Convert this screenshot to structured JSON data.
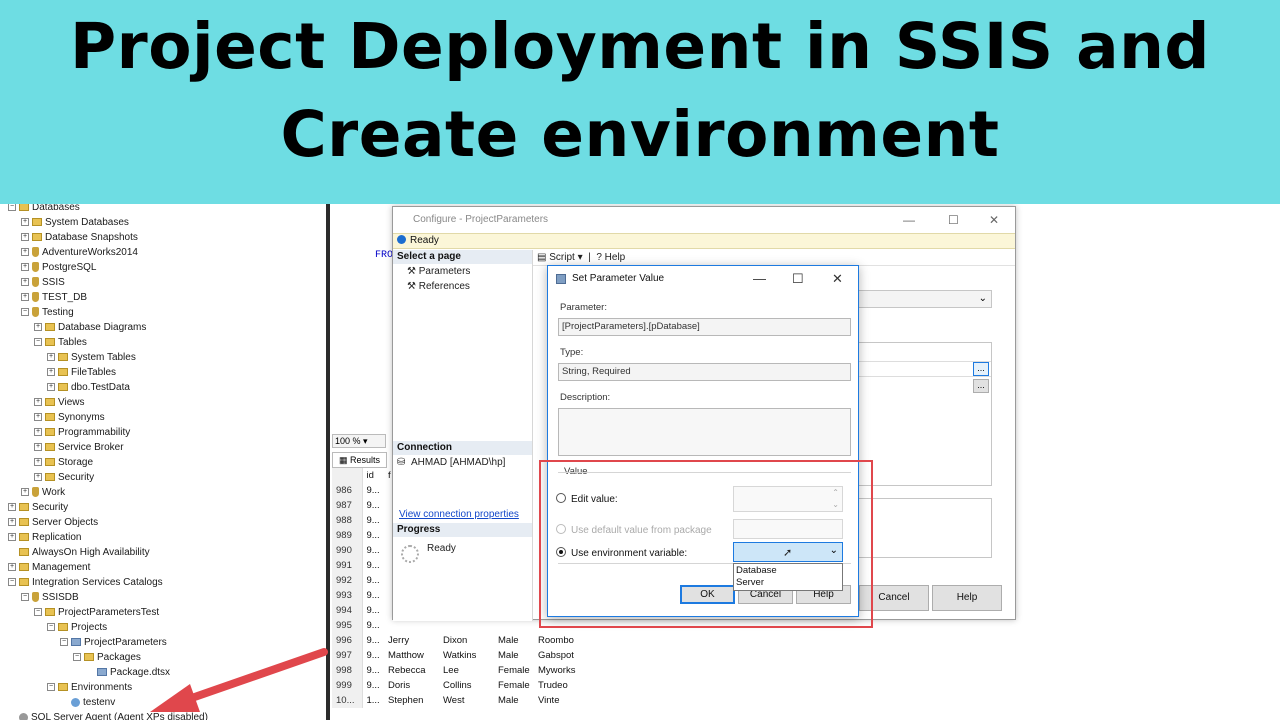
{
  "banner": {
    "line1": "Project Deployment in SSIS and",
    "line2": "Create environment"
  },
  "explorer": {
    "items": [
      {
        "label": "Databases",
        "level": 0,
        "icon": "folder-icon",
        "expander": "−"
      },
      {
        "label": "System Databases",
        "level": 1,
        "icon": "folder-icon",
        "expander": "+"
      },
      {
        "label": "Database Snapshots",
        "level": 1,
        "icon": "folder-icon",
        "expander": "+"
      },
      {
        "label": "AdventureWorks2014",
        "level": 1,
        "icon": "database-icon",
        "expander": "+"
      },
      {
        "label": "PostgreSQL",
        "level": 1,
        "icon": "database-icon",
        "expander": "+"
      },
      {
        "label": "SSIS",
        "level": 1,
        "icon": "database-icon",
        "expander": "+"
      },
      {
        "label": "TEST_DB",
        "level": 1,
        "icon": "database-icon",
        "expander": "+"
      },
      {
        "label": "Testing",
        "level": 1,
        "icon": "database-icon",
        "expander": "−"
      },
      {
        "label": "Database Diagrams",
        "level": 2,
        "icon": "folder-icon",
        "expander": "+"
      },
      {
        "label": "Tables",
        "level": 2,
        "icon": "folder-icon",
        "expander": "−"
      },
      {
        "label": "System Tables",
        "level": 3,
        "icon": "folder-icon",
        "expander": "+"
      },
      {
        "label": "FileTables",
        "level": 3,
        "icon": "folder-icon",
        "expander": "+"
      },
      {
        "label": "dbo.TestData",
        "level": 3,
        "icon": "table-icon",
        "expander": "+"
      },
      {
        "label": "Views",
        "level": 2,
        "icon": "folder-icon",
        "expander": "+"
      },
      {
        "label": "Synonyms",
        "level": 2,
        "icon": "folder-icon",
        "expander": "+"
      },
      {
        "label": "Programmability",
        "level": 2,
        "icon": "folder-icon",
        "expander": "+"
      },
      {
        "label": "Service Broker",
        "level": 2,
        "icon": "folder-icon",
        "expander": "+"
      },
      {
        "label": "Storage",
        "level": 2,
        "icon": "folder-icon",
        "expander": "+"
      },
      {
        "label": "Security",
        "level": 2,
        "icon": "folder-icon",
        "expander": "+"
      },
      {
        "label": "Work",
        "level": 1,
        "icon": "database-icon",
        "expander": "+"
      },
      {
        "label": "Security",
        "level": 0,
        "icon": "folder-icon",
        "expander": "+"
      },
      {
        "label": "Server Objects",
        "level": 0,
        "icon": "folder-icon",
        "expander": "+"
      },
      {
        "label": "Replication",
        "level": 0,
        "icon": "folder-icon",
        "expander": "+"
      },
      {
        "label": "AlwaysOn High Availability",
        "level": 0,
        "icon": "folder-icon",
        "expander": ""
      },
      {
        "label": "Management",
        "level": 0,
        "icon": "folder-icon",
        "expander": "+"
      },
      {
        "label": "Integration Services Catalogs",
        "level": 0,
        "icon": "folder-icon",
        "expander": "−"
      },
      {
        "label": "SSISDB",
        "level": 1,
        "icon": "catalog-icon",
        "expander": "−"
      },
      {
        "label": "ProjectParametersTest",
        "level": 2,
        "icon": "folder-icon",
        "expander": "−"
      },
      {
        "label": "Projects",
        "level": 3,
        "icon": "folder-icon",
        "expander": "−"
      },
      {
        "label": "ProjectParameters",
        "level": 4,
        "icon": "project-icon",
        "expander": "−"
      },
      {
        "label": "Packages",
        "level": 5,
        "icon": "folder-icon",
        "expander": "−"
      },
      {
        "label": "Package.dtsx",
        "level": 6,
        "icon": "package-icon",
        "expander": ""
      },
      {
        "label": "Environments",
        "level": 3,
        "icon": "folder-icon",
        "expander": "−"
      },
      {
        "label": "testenv",
        "level": 4,
        "icon": "environment-icon",
        "expander": ""
      },
      {
        "label": "SQL Server Agent (Agent XPs disabled)",
        "level": 0,
        "icon": "agent-icon",
        "expander": ""
      }
    ]
  },
  "editor": {
    "code_keyword": "FRO",
    "zoom": "100 %",
    "results_tab": "Results",
    "grid_header": [
      "",
      "id",
      "f"
    ],
    "rows": [
      [
        "986",
        "9...",
        "",
        "",
        "",
        ""
      ],
      [
        "987",
        "9...",
        "",
        "",
        "",
        ""
      ],
      [
        "988",
        "9...",
        "",
        "",
        "",
        ""
      ],
      [
        "989",
        "9...",
        "",
        "",
        "",
        ""
      ],
      [
        "990",
        "9...",
        "",
        "",
        "",
        ""
      ],
      [
        "991",
        "9...",
        "",
        "",
        "",
        ""
      ],
      [
        "992",
        "9...",
        "",
        "",
        "",
        ""
      ],
      [
        "993",
        "9...",
        "",
        "",
        "",
        ""
      ],
      [
        "994",
        "9...",
        "",
        "",
        "",
        ""
      ],
      [
        "995",
        "9...",
        "",
        "",
        "",
        ""
      ],
      [
        "996",
        "9...",
        "Jerry",
        "Dixon",
        "Male",
        "Roombo"
      ],
      [
        "997",
        "9...",
        "Matthow",
        "Watkins",
        "Male",
        "Gabspot"
      ],
      [
        "998",
        "9...",
        "Rebecca",
        "Lee",
        "Female",
        "Myworks"
      ],
      [
        "999",
        "9...",
        "Doris",
        "Collins",
        "Female",
        "Trudeo"
      ],
      [
        "10...",
        "1...",
        "Stephen",
        "West",
        "Male",
        "Vinte"
      ]
    ]
  },
  "configure": {
    "title": "Configure - ProjectParameters",
    "status": "Ready",
    "select_page": "Select a page",
    "pages": [
      "Parameters",
      "References"
    ],
    "toolbar_script": "Script",
    "toolbar_help": "Help",
    "connection_head": "Connection",
    "connection_value": "AHMAD [AHMAD\\hp]",
    "view_connection": "View connection properties",
    "progress_head": "Progress",
    "progress_value": "Ready",
    "cancel_label": "Cancel",
    "help_label": "Help"
  },
  "spv": {
    "title": "Set Parameter Value",
    "parameter_label": "Parameter:",
    "parameter_value": "[ProjectParameters].[pDatabase]",
    "type_label": "Type:",
    "type_value": "String, Required",
    "description_label": "Description:",
    "description_value": "",
    "value_group": "Value",
    "edit_value": "Edit value:",
    "use_default": "Use default value from package",
    "use_env": "Use environment variable:",
    "selected_option": "use_env",
    "env_options": [
      "Database",
      "Server"
    ],
    "ok_label": "OK",
    "cancel_label": "Cancel",
    "help_label": "Help"
  },
  "colors": {
    "banner": "#6edde3",
    "highlight_box": "#e0474c",
    "arrow": "#e0474c",
    "accent": "#1d7ae0"
  }
}
